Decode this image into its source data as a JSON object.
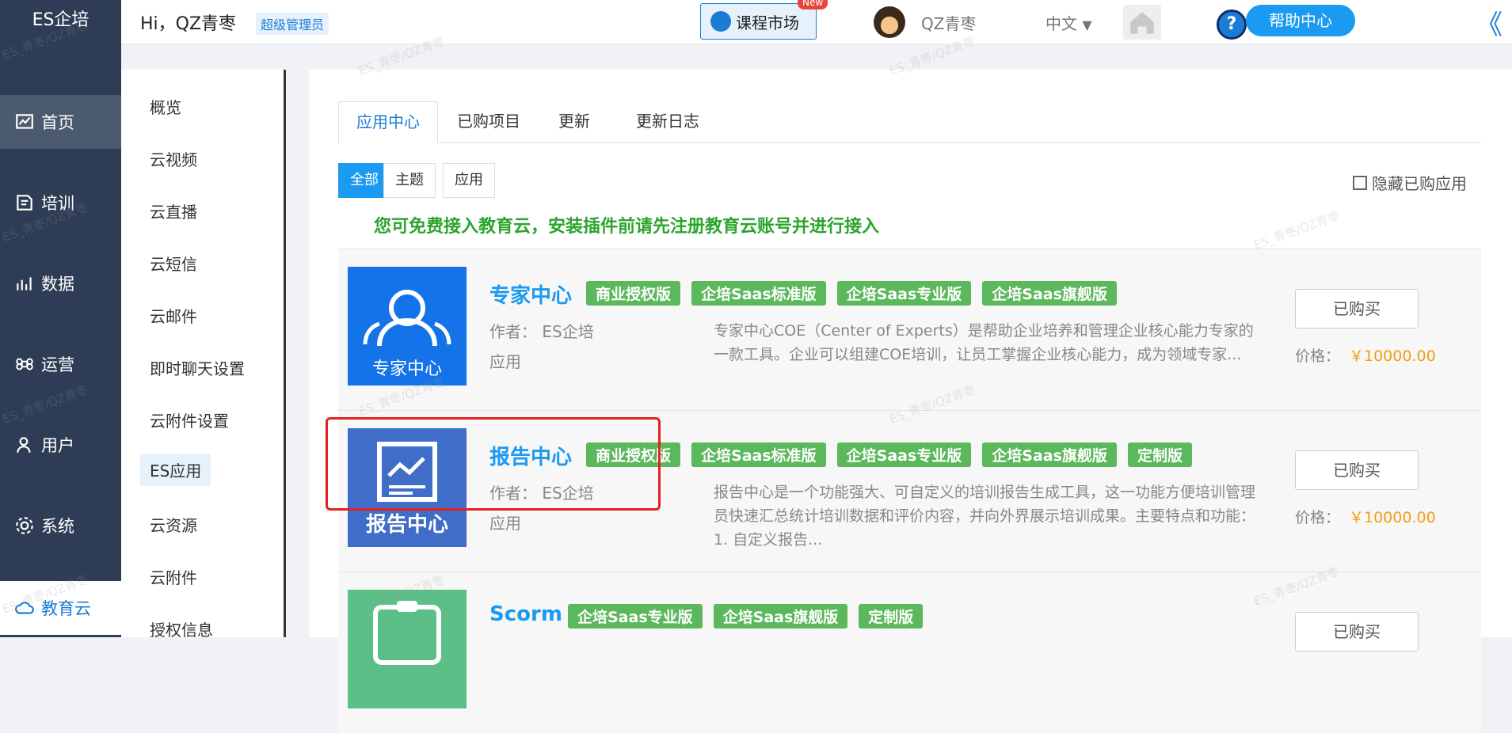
{
  "sidebar": {
    "logo": "ES企培",
    "items": [
      {
        "label": "首页",
        "icon": "chart-icon"
      },
      {
        "label": "培训",
        "icon": "book-icon"
      },
      {
        "label": "数据",
        "icon": "trend-icon"
      },
      {
        "label": "运营",
        "icon": "command-icon"
      },
      {
        "label": "用户",
        "icon": "user-icon"
      },
      {
        "label": "系统",
        "icon": "gear-icon"
      },
      {
        "label": "教育云",
        "icon": "cloud-icon"
      }
    ]
  },
  "header": {
    "greeting": "Hi，QZ青枣",
    "role": "超级管理员",
    "market_label": "课程市场",
    "new_badge": "New",
    "username": "QZ青枣",
    "language": "中文",
    "help_label": "帮助中心",
    "help_mark": "?",
    "collapse": "《"
  },
  "submenu": [
    "概览",
    "云视频",
    "云直播",
    "云短信",
    "云邮件",
    "即时聊天设置",
    "云附件设置",
    "ES应用",
    "云资源",
    "云附件",
    "授权信息"
  ],
  "tabs": [
    "应用中心",
    "已购项目",
    "更新",
    "更新日志"
  ],
  "filters": [
    "全部",
    "主题",
    "应用"
  ],
  "hide_bought": "隐藏已购应用",
  "notice": "您可免费接入教育云，安装插件前请先注册教育云账号并进行接入",
  "apps": [
    {
      "title": "专家中心",
      "thumb_text": "专家中心",
      "tags": [
        "商业授权版",
        "企培Saas标准版",
        "企培Saas专业版",
        "企培Saas旗舰版"
      ],
      "author": "作者：  ES企培",
      "kind": "应用",
      "desc": "专家中心COE（Center of Experts）是帮助企业培养和管理企业核心能力专家的一款工具。企业可以组建COE培训，让员工掌握企业核心能力，成为领域专家...",
      "button": "已购买",
      "price_label": "价格：",
      "price": "￥10000.00",
      "thumb_color": "#1573ea"
    },
    {
      "title": "报告中心",
      "thumb_text": "报告中心",
      "tags": [
        "商业授权版",
        "企培Saas标准版",
        "企培Saas专业版",
        "企培Saas旗舰版",
        "定制版"
      ],
      "author": "作者：  ES企培",
      "kind": "应用",
      "desc": "报告中心是一个功能强大、可自定义的培训报告生成工具，这一功能方便培训管理员快速汇总统计培训数据和评价内容，并向外界展示培训成果。主要特点和功能：1. 自定义报告...",
      "button": "已购买",
      "price_label": "价格：",
      "price": "￥10000.00",
      "thumb_color": "#3f6dc8"
    },
    {
      "title": "Scorm",
      "thumb_text": "",
      "tags": [
        "企培Saas专业版",
        "企培Saas旗舰版",
        "定制版"
      ],
      "author": "",
      "kind": "",
      "desc": "",
      "button": "已购买",
      "price_label": "",
      "price": "",
      "thumb_color": "#5cbf87"
    }
  ],
  "watermark": "ES_青枣/QZ青枣"
}
